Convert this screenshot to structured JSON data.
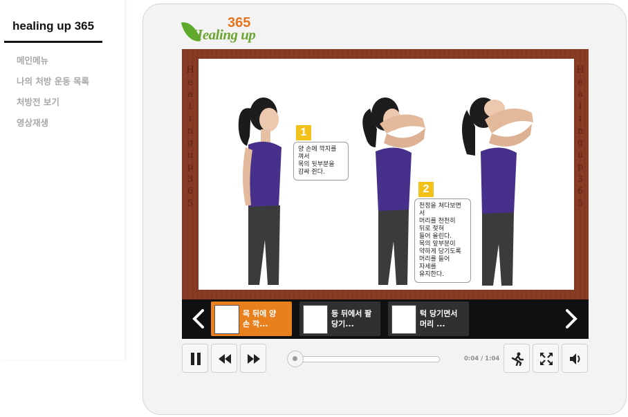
{
  "sidebar": {
    "title": "healing up 365",
    "menu": [
      "메인메뉴",
      "나의 처방 운동 목록",
      "처방전 보기",
      "영상재생"
    ]
  },
  "logo": {
    "word": "Healing up",
    "number": "365"
  },
  "stage": {
    "border_letters": [
      "H",
      "e",
      "a",
      "l",
      "i",
      "n",
      "g",
      "u",
      "p",
      "3",
      "6",
      "5"
    ],
    "steps": [
      {
        "number": "1",
        "text_lines": [
          "양 손에 깍지를 껴서",
          "목의 뒷부분을",
          "감싸 쥔다."
        ]
      },
      {
        "number": "2",
        "text_lines": [
          "천정을 쳐다보면서",
          "머리를 천천히",
          "뒤로 젖혀",
          "들어 올린다.",
          "목의 앞부분이",
          "약하게 당기도록",
          "머리를 들어",
          "자세를",
          "유지한다."
        ]
      }
    ]
  },
  "playlist": {
    "items": [
      {
        "label_line1": "목 뒤에 양",
        "label_line2": "손 깍...",
        "active": true
      },
      {
        "label_line1": "등 뒤에서 팔",
        "label_line2": "당기...",
        "active": false
      },
      {
        "label_line1": "턱 당기면서",
        "label_line2": "머리 ...",
        "active": false
      }
    ]
  },
  "player": {
    "time": "0:04 / 1:04",
    "progress_fraction": 0.06
  },
  "icons": {
    "prev": "chevron-left-icon",
    "next": "chevron-right-icon",
    "pause": "pause-icon",
    "rewind": "rewind-icon",
    "forward": "fast-forward-icon",
    "exercise": "running-person-icon",
    "fullscreen": "fullscreen-icon",
    "volume": "volume-icon"
  },
  "colors": {
    "accent": "#e8811d",
    "stage": "#8a3b24",
    "step_badge": "#f2c21b"
  }
}
